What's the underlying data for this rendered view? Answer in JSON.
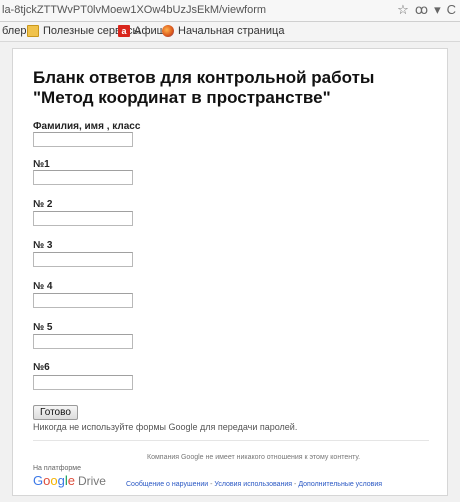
{
  "browser": {
    "url": "la-8tjckZTTWvPT0lvMoew1XOw4bUzJsEkM/viewform",
    "star_icon": "star-icon",
    "bookmarks": [
      {
        "label": "блер",
        "icon": ""
      },
      {
        "label": "Полезные сервисы",
        "icon": "folder-icon"
      },
      {
        "label": "Афиша",
        "icon": "afisha-icon"
      },
      {
        "label": "Начальная страница",
        "icon": "firefox-icon"
      }
    ]
  },
  "form": {
    "title": "Бланк ответов для контрольной работы \"Метод координат в пространстве\"",
    "questions": [
      {
        "label": "Фамилия, имя , класс",
        "value": ""
      },
      {
        "label": "№1",
        "value": ""
      },
      {
        "label": "№ 2",
        "value": ""
      },
      {
        "label": "№ 3",
        "value": ""
      },
      {
        "label": "№ 4",
        "value": ""
      },
      {
        "label": "№ 5",
        "value": ""
      },
      {
        "label": "№6",
        "value": ""
      }
    ],
    "submit_label": "Готово",
    "password_note": "Никогда не используйте формы Google для передачи паролей."
  },
  "footer": {
    "disclaimer": "Компания Google не имеет никакого отношения к этому контенту.",
    "platform": "На платформе",
    "logo_google": [
      "G",
      "o",
      "o",
      "g",
      "l",
      "e"
    ],
    "logo_drive": "Drive",
    "links": [
      "Сообщение о нарушении",
      "Условия использования",
      "Дополнительные условия"
    ],
    "link_separator": " - "
  }
}
